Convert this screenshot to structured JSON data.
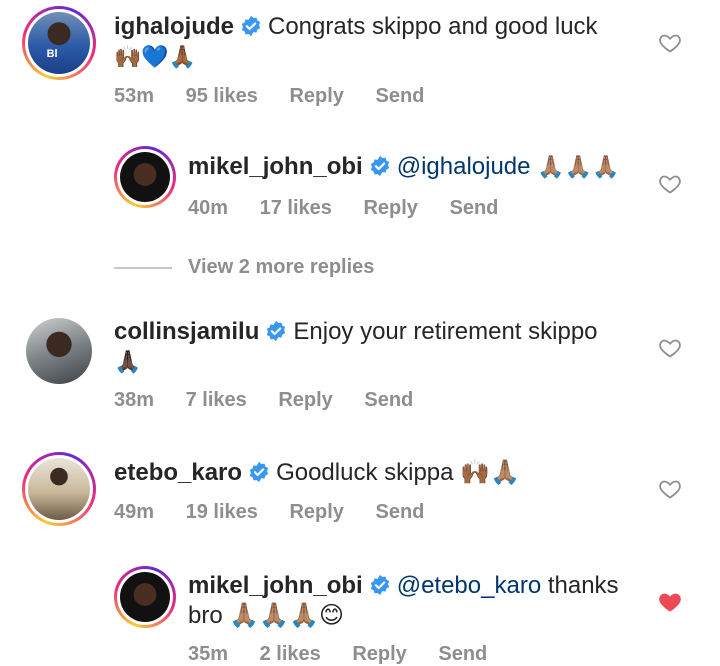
{
  "comments": [
    {
      "username": "ighalojude",
      "text_line1": "Congrats skippo and good luck",
      "text_line2": "🙌🏾💙🙏🏾",
      "age": "53m",
      "likes": "95 likes",
      "reply": "Reply",
      "send": "Send",
      "liked": false
    },
    {
      "username": "mikel_john_obi",
      "mention": "@ighalojude",
      "text_after": "🙏🏽🙏🏽🙏🏽",
      "age": "40m",
      "likes": "17 likes",
      "reply": "Reply",
      "send": "Send",
      "liked": false
    },
    {
      "username": "collinsjamilu",
      "text_line1": "Enjoy your retirement skippo",
      "text_line2": "🙏🏿",
      "age": "38m",
      "likes": "7 likes",
      "reply": "Reply",
      "send": "Send",
      "liked": false
    },
    {
      "username": "etebo_karo",
      "text_line1": "Goodluck skippa 🙌🏾🙏🏽",
      "age": "49m",
      "likes": "19 likes",
      "reply": "Reply",
      "send": "Send",
      "liked": false
    },
    {
      "username": "mikel_john_obi",
      "mention": "@etebo_karo",
      "text_after": "thanks",
      "text_line2": "bro 🙏🏽🙏🏽🙏🏽😊",
      "age": "35m",
      "likes": "2 likes",
      "reply": "Reply",
      "send": "Send",
      "liked": true
    }
  ],
  "view_more": "View 2 more replies",
  "colors": {
    "verified": "#3897f0",
    "heart_liked": "#ed4956",
    "meta": "#8e8e8e",
    "mention": "#00376b"
  }
}
